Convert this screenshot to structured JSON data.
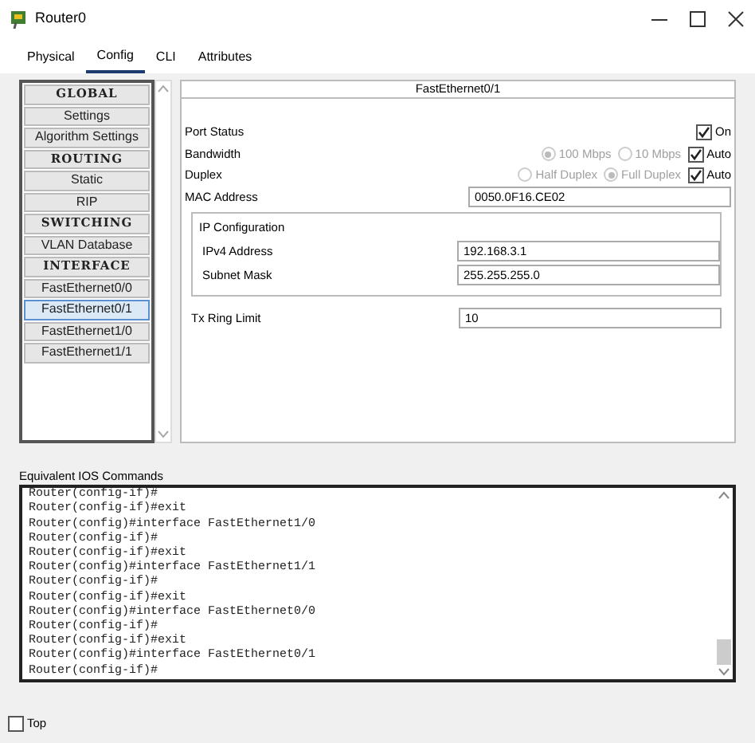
{
  "window": {
    "title": "Router0"
  },
  "tabs": [
    {
      "label": "Physical",
      "selected": false
    },
    {
      "label": "Config",
      "selected": true
    },
    {
      "label": "CLI",
      "selected": false
    },
    {
      "label": "Attributes",
      "selected": false
    }
  ],
  "sidebar": {
    "items": [
      {
        "kind": "header",
        "label": "GLOBAL",
        "selected": false
      },
      {
        "kind": "item",
        "label": "Settings",
        "selected": false
      },
      {
        "kind": "item",
        "label": "Algorithm Settings",
        "selected": false
      },
      {
        "kind": "header",
        "label": "ROUTING",
        "selected": false
      },
      {
        "kind": "item",
        "label": "Static",
        "selected": false
      },
      {
        "kind": "item",
        "label": "RIP",
        "selected": false
      },
      {
        "kind": "header",
        "label": "SWITCHING",
        "selected": false
      },
      {
        "kind": "item",
        "label": "VLAN Database",
        "selected": false
      },
      {
        "kind": "header",
        "label": "INTERFACE",
        "selected": false
      },
      {
        "kind": "item",
        "label": "FastEthernet0/0",
        "selected": false
      },
      {
        "kind": "item",
        "label": "FastEthernet0/1",
        "selected": true
      },
      {
        "kind": "item",
        "label": "FastEthernet1/0",
        "selected": false
      },
      {
        "kind": "item",
        "label": "FastEthernet1/1",
        "selected": false
      }
    ]
  },
  "panel": {
    "title": "FastEthernet0/1",
    "port_status": {
      "label": "Port Status",
      "on": {
        "label": "On",
        "checked": true
      }
    },
    "bandwidth": {
      "label": "Bandwidth",
      "disabled": true,
      "options": [
        {
          "label": "100 Mbps",
          "selected": true
        },
        {
          "label": "10 Mbps",
          "selected": false
        }
      ],
      "auto": {
        "label": "Auto",
        "checked": true
      }
    },
    "duplex": {
      "label": "Duplex",
      "disabled": true,
      "options": [
        {
          "label": "Half Duplex",
          "selected": false
        },
        {
          "label": "Full Duplex",
          "selected": true
        }
      ],
      "auto": {
        "label": "Auto",
        "checked": true
      }
    },
    "mac": {
      "label": "MAC Address",
      "value": "0050.0F16.CE02"
    },
    "ip_config": {
      "title": "IP Configuration",
      "fields": [
        {
          "label": "IPv4 Address",
          "value": "192.168.3.1"
        },
        {
          "label": "Subnet Mask",
          "value": "255.255.255.0"
        }
      ]
    },
    "tx_ring": {
      "label": "Tx Ring Limit",
      "value": "10"
    }
  },
  "ios": {
    "label": "Equivalent IOS Commands",
    "lines": [
      "Router(config-if)#",
      "Router(config-if)#exit",
      "Router(config)#interface FastEthernet1/0",
      "Router(config-if)#",
      "Router(config-if)#exit",
      "Router(config)#interface FastEthernet1/1",
      "Router(config-if)#",
      "Router(config-if)#exit",
      "Router(config)#interface FastEthernet0/0",
      "Router(config-if)#",
      "Router(config-if)#exit",
      "Router(config)#interface FastEthernet0/1",
      "Router(config-if)#"
    ]
  },
  "footer": {
    "top": {
      "label": "Top",
      "checked": false
    }
  }
}
